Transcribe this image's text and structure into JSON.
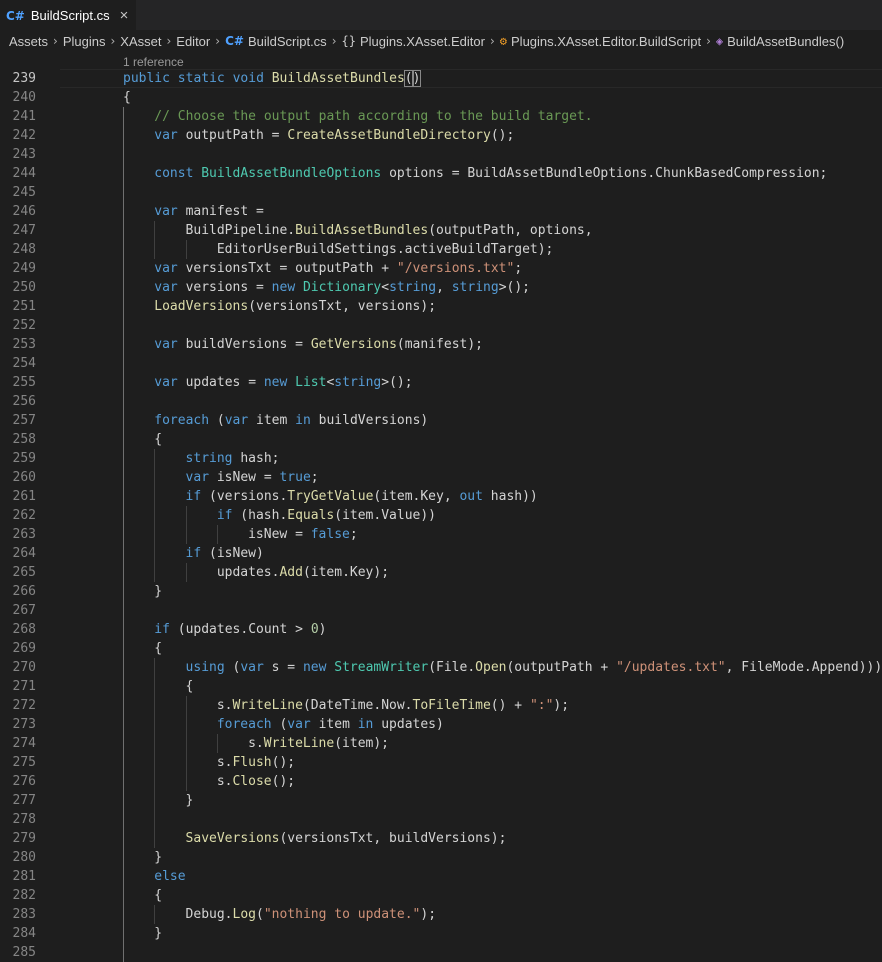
{
  "tab": {
    "icon": "csharp-file-icon",
    "label": "BuildScript.cs",
    "close": "×"
  },
  "breadcrumb": [
    {
      "label": "Assets",
      "icon": ""
    },
    {
      "label": "Plugins",
      "icon": ""
    },
    {
      "label": "XAsset",
      "icon": ""
    },
    {
      "label": "Editor",
      "icon": ""
    },
    {
      "label": "BuildScript.cs",
      "icon": "csharp-file-icon"
    },
    {
      "label": "Plugins.XAsset.Editor",
      "icon": "namespace-icon"
    },
    {
      "label": "Plugins.XAsset.Editor.BuildScript",
      "icon": "class-icon"
    },
    {
      "label": "BuildAssetBundles()",
      "icon": "method-icon"
    }
  ],
  "codelens": "1 reference",
  "colors": {
    "keyword": "#569cd6",
    "type": "#4ec9b0",
    "function": "#dcdcaa",
    "string": "#ce9178",
    "number": "#b5cea8",
    "comment": "#6a9955",
    "background": "#1e1e1e",
    "line_number": "#858585"
  },
  "code_lines": [
    {
      "n": "239",
      "indent": 0,
      "tokens": [
        [
          "kw",
          "public"
        ],
        [
          "",
          ""
        ],
        [
          "kw",
          " static"
        ],
        [
          "kw",
          " void"
        ],
        [
          "",
          " "
        ],
        [
          "fn",
          "BuildAssetBundles"
        ],
        [
          "bh",
          "()"
        ]
      ]
    },
    {
      "n": "240",
      "indent": 0,
      "tokens": [
        [
          "",
          "{"
        ]
      ]
    },
    {
      "n": "241",
      "indent": 1,
      "tokens": [
        [
          "cm",
          "// Choose the output path according to the build target."
        ]
      ]
    },
    {
      "n": "242",
      "indent": 1,
      "tokens": [
        [
          "kw",
          "var"
        ],
        [
          "",
          " outputPath = "
        ],
        [
          "fn",
          "CreateAssetBundleDirectory"
        ],
        [
          "",
          "();"
        ]
      ]
    },
    {
      "n": "243",
      "indent": 1,
      "tokens": []
    },
    {
      "n": "244",
      "indent": 1,
      "tokens": [
        [
          "kw",
          "const"
        ],
        [
          "",
          " "
        ],
        [
          "ty",
          "BuildAssetBundleOptions"
        ],
        [
          "",
          " options = BuildAssetBundleOptions.ChunkBasedCompression;"
        ]
      ]
    },
    {
      "n": "245",
      "indent": 1,
      "tokens": []
    },
    {
      "n": "246",
      "indent": 1,
      "tokens": [
        [
          "kw",
          "var"
        ],
        [
          "",
          " manifest ="
        ]
      ]
    },
    {
      "n": "247",
      "indent": 2,
      "tokens": [
        [
          "",
          "BuildPipeline."
        ],
        [
          "fn",
          "BuildAssetBundles"
        ],
        [
          "",
          "(outputPath, options,"
        ]
      ]
    },
    {
      "n": "248",
      "indent": 3,
      "tokens": [
        [
          "",
          "EditorUserBuildSettings.activeBuildTarget);"
        ]
      ]
    },
    {
      "n": "249",
      "indent": 1,
      "tokens": [
        [
          "kw",
          "var"
        ],
        [
          "",
          " versionsTxt = outputPath + "
        ],
        [
          "str",
          "\"/versions.txt\""
        ],
        [
          "",
          ";"
        ]
      ]
    },
    {
      "n": "250",
      "indent": 1,
      "tokens": [
        [
          "kw",
          "var"
        ],
        [
          "",
          " versions = "
        ],
        [
          "kw",
          "new"
        ],
        [
          "",
          " "
        ],
        [
          "ty",
          "Dictionary"
        ],
        [
          "",
          "<"
        ],
        [
          "kw",
          "string"
        ],
        [
          "",
          ", "
        ],
        [
          "kw",
          "string"
        ],
        [
          "",
          ">();"
        ]
      ]
    },
    {
      "n": "251",
      "indent": 1,
      "tokens": [
        [
          "fn",
          "LoadVersions"
        ],
        [
          "",
          "(versionsTxt, versions);"
        ]
      ]
    },
    {
      "n": "252",
      "indent": 1,
      "tokens": []
    },
    {
      "n": "253",
      "indent": 1,
      "tokens": [
        [
          "kw",
          "var"
        ],
        [
          "",
          " buildVersions = "
        ],
        [
          "fn",
          "GetVersions"
        ],
        [
          "",
          "(manifest);"
        ]
      ]
    },
    {
      "n": "254",
      "indent": 1,
      "tokens": []
    },
    {
      "n": "255",
      "indent": 1,
      "tokens": [
        [
          "kw",
          "var"
        ],
        [
          "",
          " updates = "
        ],
        [
          "kw",
          "new"
        ],
        [
          "",
          " "
        ],
        [
          "ty",
          "List"
        ],
        [
          "",
          "<"
        ],
        [
          "kw",
          "string"
        ],
        [
          "",
          ">();"
        ]
      ]
    },
    {
      "n": "256",
      "indent": 1,
      "tokens": []
    },
    {
      "n": "257",
      "indent": 1,
      "tokens": [
        [
          "kw",
          "foreach"
        ],
        [
          "",
          " ("
        ],
        [
          "kw",
          "var"
        ],
        [
          "",
          " item "
        ],
        [
          "kw",
          "in"
        ],
        [
          "",
          " buildVersions)"
        ]
      ]
    },
    {
      "n": "258",
      "indent": 1,
      "tokens": [
        [
          "",
          "{"
        ]
      ]
    },
    {
      "n": "259",
      "indent": 2,
      "tokens": [
        [
          "kw",
          "string"
        ],
        [
          "",
          " hash;"
        ]
      ]
    },
    {
      "n": "260",
      "indent": 2,
      "tokens": [
        [
          "kw",
          "var"
        ],
        [
          "",
          " isNew = "
        ],
        [
          "kw",
          "true"
        ],
        [
          "",
          ";"
        ]
      ]
    },
    {
      "n": "261",
      "indent": 2,
      "tokens": [
        [
          "kw",
          "if"
        ],
        [
          "",
          " (versions."
        ],
        [
          "fn",
          "TryGetValue"
        ],
        [
          "",
          "(item.Key, "
        ],
        [
          "kw",
          "out"
        ],
        [
          "",
          " hash))"
        ]
      ]
    },
    {
      "n": "262",
      "indent": 3,
      "tokens": [
        [
          "kw",
          "if"
        ],
        [
          "",
          " (hash."
        ],
        [
          "fn",
          "Equals"
        ],
        [
          "",
          "(item.Value))"
        ]
      ]
    },
    {
      "n": "263",
      "indent": 4,
      "tokens": [
        [
          "",
          "isNew = "
        ],
        [
          "kw",
          "false"
        ],
        [
          "",
          ";"
        ]
      ]
    },
    {
      "n": "264",
      "indent": 2,
      "tokens": [
        [
          "kw",
          "if"
        ],
        [
          "",
          " (isNew)"
        ]
      ]
    },
    {
      "n": "265",
      "indent": 3,
      "tokens": [
        [
          "",
          "updates."
        ],
        [
          "fn",
          "Add"
        ],
        [
          "",
          "(item.Key);"
        ]
      ]
    },
    {
      "n": "266",
      "indent": 1,
      "tokens": [
        [
          "",
          "}"
        ]
      ]
    },
    {
      "n": "267",
      "indent": 1,
      "tokens": []
    },
    {
      "n": "268",
      "indent": 1,
      "tokens": [
        [
          "kw",
          "if"
        ],
        [
          "",
          " (updates.Count > "
        ],
        [
          "num",
          "0"
        ],
        [
          "",
          ")"
        ]
      ]
    },
    {
      "n": "269",
      "indent": 1,
      "tokens": [
        [
          "",
          "{"
        ]
      ]
    },
    {
      "n": "270",
      "indent": 2,
      "tokens": [
        [
          "kw",
          "using"
        ],
        [
          "",
          " ("
        ],
        [
          "kw",
          "var"
        ],
        [
          "",
          " s = "
        ],
        [
          "kw",
          "new"
        ],
        [
          "",
          " "
        ],
        [
          "ty",
          "StreamWriter"
        ],
        [
          "",
          "(File."
        ],
        [
          "fn",
          "Open"
        ],
        [
          "",
          "(outputPath + "
        ],
        [
          "str",
          "\"/updates.txt\""
        ],
        [
          "",
          ", FileMode.Append)))"
        ]
      ]
    },
    {
      "n": "271",
      "indent": 2,
      "tokens": [
        [
          "",
          "{"
        ]
      ]
    },
    {
      "n": "272",
      "indent": 3,
      "tokens": [
        [
          "",
          "s."
        ],
        [
          "fn",
          "WriteLine"
        ],
        [
          "",
          "(DateTime.Now."
        ],
        [
          "fn",
          "ToFileTime"
        ],
        [
          "",
          "() + "
        ],
        [
          "str",
          "\":\""
        ],
        [
          "",
          ");"
        ]
      ]
    },
    {
      "n": "273",
      "indent": 3,
      "tokens": [
        [
          "kw",
          "foreach"
        ],
        [
          "",
          " ("
        ],
        [
          "kw",
          "var"
        ],
        [
          "",
          " item "
        ],
        [
          "kw",
          "in"
        ],
        [
          "",
          " updates)"
        ]
      ]
    },
    {
      "n": "274",
      "indent": 4,
      "tokens": [
        [
          "",
          "s."
        ],
        [
          "fn",
          "WriteLine"
        ],
        [
          "",
          "(item);"
        ]
      ]
    },
    {
      "n": "275",
      "indent": 3,
      "tokens": [
        [
          "",
          "s."
        ],
        [
          "fn",
          "Flush"
        ],
        [
          "",
          "();"
        ]
      ]
    },
    {
      "n": "276",
      "indent": 3,
      "tokens": [
        [
          "",
          "s."
        ],
        [
          "fn",
          "Close"
        ],
        [
          "",
          "();"
        ]
      ]
    },
    {
      "n": "277",
      "indent": 2,
      "tokens": [
        [
          "",
          "}"
        ]
      ]
    },
    {
      "n": "278",
      "indent": 2,
      "tokens": []
    },
    {
      "n": "279",
      "indent": 2,
      "tokens": [
        [
          "fn",
          "SaveVersions"
        ],
        [
          "",
          "(versionsTxt, buildVersions);"
        ]
      ]
    },
    {
      "n": "280",
      "indent": 1,
      "tokens": [
        [
          "",
          "}"
        ]
      ]
    },
    {
      "n": "281",
      "indent": 1,
      "tokens": [
        [
          "kw",
          "else"
        ]
      ]
    },
    {
      "n": "282",
      "indent": 1,
      "tokens": [
        [
          "",
          "{"
        ]
      ]
    },
    {
      "n": "283",
      "indent": 2,
      "tokens": [
        [
          "",
          "Debug."
        ],
        [
          "fn",
          "Log"
        ],
        [
          "",
          "("
        ],
        [
          "str",
          "\"nothing to update.\""
        ],
        [
          "",
          ");"
        ]
      ]
    },
    {
      "n": "284",
      "indent": 1,
      "tokens": [
        [
          "",
          "}"
        ]
      ]
    },
    {
      "n": "285",
      "indent": 1,
      "tokens": []
    }
  ]
}
